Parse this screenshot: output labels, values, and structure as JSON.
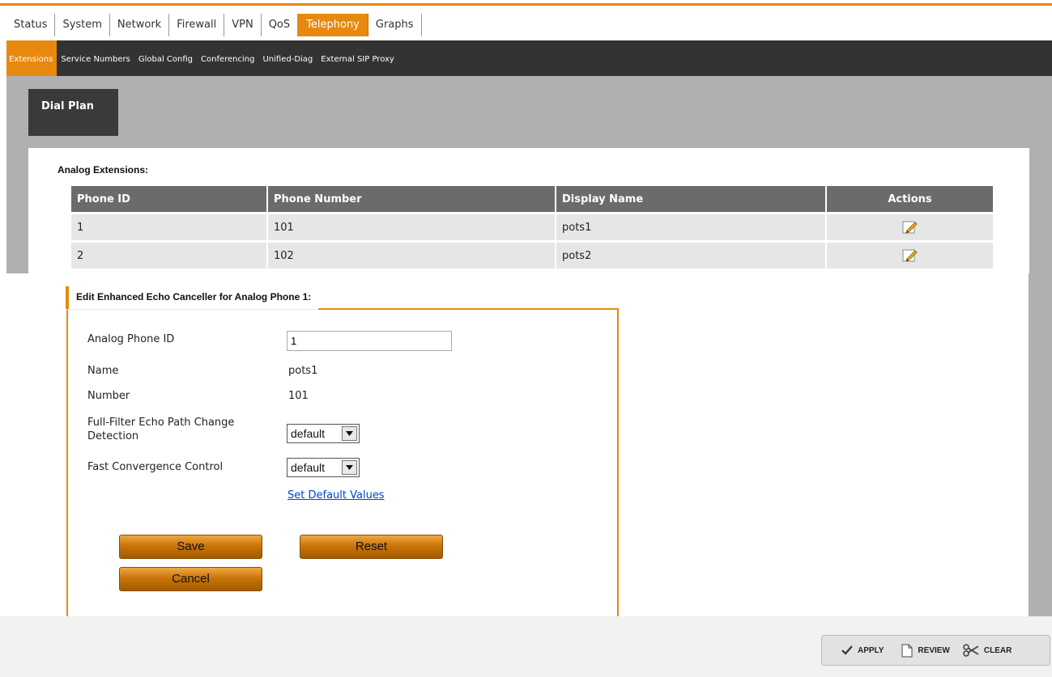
{
  "main_nav": {
    "tabs": [
      "Status",
      "System",
      "Network",
      "Firewall",
      "VPN",
      "QoS",
      "Telephony",
      "Graphs"
    ],
    "active": "Telephony"
  },
  "sub_nav": {
    "tabs": [
      "Extensions",
      "Service Numbers",
      "Global Config",
      "Conferencing",
      "Unified-Diag",
      "External SIP Proxy"
    ],
    "active": "Extensions"
  },
  "page_tab": "Dial Plan",
  "analog_extensions": {
    "title": "Analog Extensions:",
    "columns": [
      "Phone ID",
      "Phone Number",
      "Display Name",
      "Actions"
    ],
    "rows": [
      {
        "phone_id": "1",
        "phone_number": "101",
        "display_name": "pots1"
      },
      {
        "phone_id": "2",
        "phone_number": "102",
        "display_name": "pots2"
      }
    ],
    "action_icon": "edit-pencil-icon"
  },
  "edit_panel": {
    "title": "Edit Enhanced Echo Canceller for Analog Phone 1:",
    "fields": {
      "analog_phone_id_label": "Analog Phone ID",
      "analog_phone_id_value": "1",
      "name_label": "Name",
      "name_value": "pots1",
      "number_label": "Number",
      "number_value": "101",
      "full_filter_label_line1": "Full-Filter Echo Path Change",
      "full_filter_label_line2": "Detection",
      "full_filter_value": "default",
      "fast_convergence_label": "Fast Convergence Control",
      "fast_convergence_value": "default"
    },
    "set_default_link": "Set Default Values",
    "buttons": {
      "save": "Save",
      "reset": "Reset",
      "cancel": "Cancel"
    }
  },
  "footer_actions": {
    "apply": "APPLY",
    "review": "REVIEW",
    "clear": "CLEAR"
  },
  "colors": {
    "accent": "#e8890f",
    "subnav_bg": "#333333",
    "header_cell": "#6b6b6b",
    "link": "#0044cc"
  }
}
